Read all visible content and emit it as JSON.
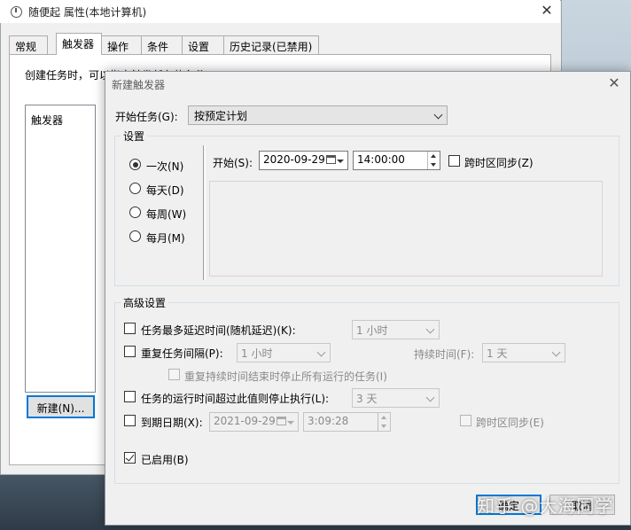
{
  "background_window": {
    "title": "随便起 属性(本地计算机)",
    "close_glyph": "✕",
    "tabs": [
      {
        "label": "常规",
        "active": false
      },
      {
        "label": "触发器",
        "active": true
      },
      {
        "label": "操作",
        "active": false
      },
      {
        "label": "条件",
        "active": false
      },
      {
        "label": "设置",
        "active": false
      },
      {
        "label": "历史记录(已禁用)",
        "active": false
      }
    ],
    "description": "创建任务时，可以指定触发任务的条件。",
    "list_header": "触发器",
    "new_button": "新建(N)..."
  },
  "dialog": {
    "title": "新建触发器",
    "close_glyph": "✕",
    "begin_task_label": "开始任务(G):",
    "begin_task_value": "按预定计划",
    "settings_legend": "设置",
    "schedule_options": [
      {
        "label": "一次(N)",
        "selected": true
      },
      {
        "label": "每天(D)",
        "selected": false
      },
      {
        "label": "每周(W)",
        "selected": false
      },
      {
        "label": "每月(M)",
        "selected": false
      }
    ],
    "start_label": "开始(S):",
    "start_date": "2020-09-29",
    "start_time": "14:00:00",
    "sync_timezone_label": "跨时区同步(Z)",
    "sync_timezone_checked": false,
    "advanced_legend": "高级设置",
    "delay": {
      "label": "任务最多延迟时间(随机延迟)(K):",
      "checked": false,
      "value": "1 小时"
    },
    "repeat": {
      "label": "重复任务间隔(P):",
      "checked": false,
      "value": "1 小时",
      "duration_label": "持续时间(F):",
      "duration_value": "1 天"
    },
    "stop_running": {
      "label": "重复持续时间结束时停止所有运行的任务(I)",
      "checked": false
    },
    "stop_if_longer": {
      "label": "任务的运行时间超过此值则停止执行(L):",
      "checked": false,
      "value": "3 天"
    },
    "expire": {
      "label": "到期日期(X):",
      "checked": false,
      "date": "2021-09-29",
      "time": "3:09:28",
      "sync_label": "跨时区同步(E)"
    },
    "enabled": {
      "label": "已启用(B)",
      "checked": true
    },
    "ok_label": "确定",
    "cancel_label": "取消"
  },
  "watermark": "知乎 @大海同学"
}
